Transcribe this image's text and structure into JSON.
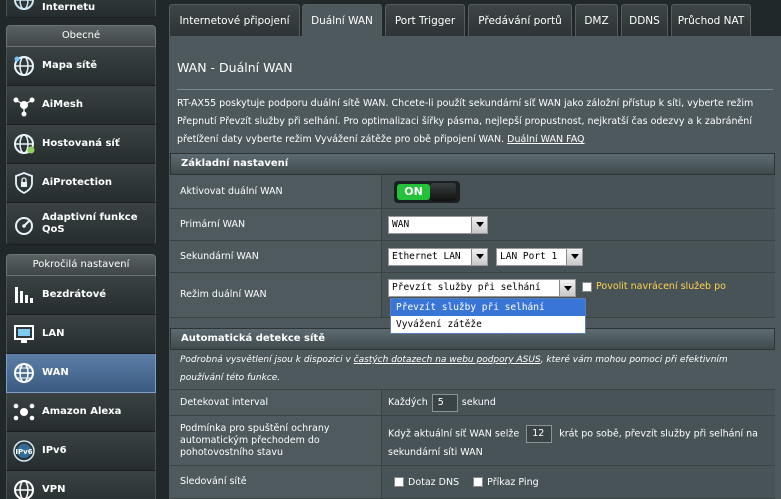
{
  "sidebar": {
    "top_item": "Internetu",
    "group_general": "Obecné",
    "general_items": [
      {
        "label": "Mapa sítě",
        "icon": "globe-icon"
      },
      {
        "label": "AiMesh",
        "icon": "mesh-icon"
      },
      {
        "label": "Hostovaná síť",
        "icon": "guest-network-icon"
      },
      {
        "label": "AiProtection",
        "icon": "shield-lock-icon"
      },
      {
        "label": "Adaptivní funkce QoS",
        "icon": "qos-icon"
      }
    ],
    "group_advanced": "Pokročilá nastavení",
    "advanced_items": [
      {
        "label": "Bezdrátové",
        "icon": "wireless-icon"
      },
      {
        "label": "LAN",
        "icon": "lan-icon"
      },
      {
        "label": "WAN",
        "icon": "wan-globe-icon"
      },
      {
        "label": "Amazon Alexa",
        "icon": "alexa-icon"
      },
      {
        "label": "IPv6",
        "icon": "ipv6-icon"
      },
      {
        "label": "VPN",
        "icon": "vpn-icon"
      }
    ]
  },
  "tabs": [
    "Internetové připojení",
    "Duální WAN",
    "Port Trigger",
    "Předávání portů",
    "DMZ",
    "DDNS",
    "Průchod NAT"
  ],
  "page": {
    "title": "WAN - Duální WAN",
    "desc_text": "RT-AX55 poskytuje podporu duální sítě WAN. Chcete-li použít sekundární síť WAN jako záložní přístup k síti, vyberte režim Přepnutí Převzít služby při selhání. Pro optimalizaci šířky pásma, nejlepší propustnost, nejkratší čas odezvy a k zabránění přetížení daty vyberte režim Vyvážení zátěže pro obě připojení WAN.",
    "desc_link": "Duální WAN FAQ"
  },
  "basic": {
    "header": "Základní nastavení",
    "enable_label": "Aktivovat duální WAN",
    "toggle_text": "ON",
    "primary_label": "Primární WAN",
    "primary_value": "WAN",
    "secondary_label": "Sekundární WAN",
    "secondary_value": "Ethernet LAN",
    "secondary_port": "LAN Port 1",
    "mode_label": "Režim duální WAN",
    "mode_value": "Převzít služby při selhání",
    "failback_label": "Povolit navrácení služeb po",
    "mode_options": [
      "Převzít služby při selhání",
      "Vyvážení zátěže"
    ]
  },
  "auto": {
    "header": "Automatická detekce sítě",
    "note_pre": "Podrobná vysvětlení jsou k dispozici v ",
    "note_link": "častých dotazech na webu podpory ASUS",
    "note_post": ", které vám mohou pomoci při efektivním používání této funkce.",
    "interval_label": "Detekovat interval",
    "interval_pre": "Každých",
    "interval_value": "5",
    "interval_unit": "sekund",
    "failover_label": "Podmínka pro spuštění ochrany automatickým přechodem do pohotovostního stavu",
    "failover_pre": "Když aktuální síť WAN selže",
    "failover_value": "12",
    "failover_post": "krát po sobě, převzít služby při selhání na sekundární síti WAN",
    "monitor_label": "Sledování sítě",
    "dns_label": "Dotaz DNS",
    "ping_label": "Příkaz Ping"
  },
  "colors": {
    "accent": "#3875d7",
    "on_green": "#23c23a",
    "failback_text": "#ffd24d"
  }
}
